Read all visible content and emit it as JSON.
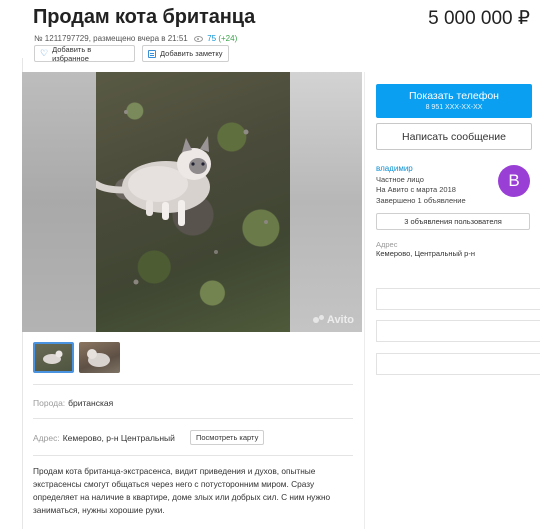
{
  "listing": {
    "title": "Продам кота британца",
    "price": "5 000 000 ₽",
    "meta_text": "№ 1211797729, размещено вчера в 21:51",
    "views": "75",
    "views_delta": "(+24)"
  },
  "actions": {
    "favorite_label": "Добавить в избранное",
    "note_label": "Добавить заметку"
  },
  "photo": {
    "watermark": "Avito"
  },
  "details": {
    "breed_label": "Порода:",
    "breed_value": "британская",
    "address_label": "Адрес:",
    "address_value": "Кемерово, р-н Центральный",
    "map_button": "Посмотреть карту",
    "description": "Продам кота британца-экстрасенса, видит приведения и духов, опытные экстрасенсы смогут общаться через него с потусторонним миром. Сразу определяет на наличие в квартире, доме злых или добрых сил. С ним нужно заниматься, нужны хорошие руки."
  },
  "sidebar": {
    "phone_button": "Показать телефон",
    "phone_number": "8 951 XXX-XX-XX",
    "message_button": "Написать сообщение",
    "seller_name": "владимир",
    "seller_type": "Частное лицо",
    "seller_since": "На Авито с марта 2018",
    "seller_completed": "Завершено 1 объявление",
    "avatar_letter": "B",
    "ads_button": "3 объявления пользователя",
    "address_label": "Адрес",
    "address_value": "Кемерово, Центральный р-н"
  },
  "colors": {
    "accent_blue": "#0a9ff0",
    "avatar_purple": "#9a3fd6",
    "link_blue": "#0a8fd1",
    "views_green": "#3aa24a"
  },
  "icons": [
    "heart-icon",
    "note-icon",
    "eye-icon",
    "avito-logo-icon"
  ]
}
